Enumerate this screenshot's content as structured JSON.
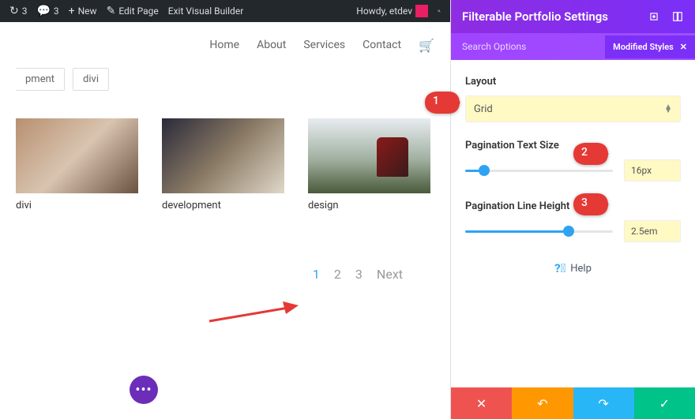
{
  "adminbar": {
    "refresh_count": "3",
    "comments_count": "3",
    "new_label": "New",
    "edit_label": "Edit Page",
    "exit_label": "Exit Visual Builder",
    "howdy": "Howdy, etdev"
  },
  "nav": {
    "items": [
      "Home",
      "About",
      "Services",
      "Contact"
    ]
  },
  "filters": [
    "pment",
    "divi"
  ],
  "portfolio_items": [
    {
      "title": "divi"
    },
    {
      "title": "development"
    },
    {
      "title": "design"
    }
  ],
  "pagination": {
    "pages": [
      "1",
      "2",
      "3"
    ],
    "next": "Next",
    "active": "1"
  },
  "callouts": {
    "c1": "1",
    "c2": "2",
    "c3": "3"
  },
  "settings": {
    "title": "Filterable Portfolio Settings",
    "search_placeholder": "Search Options",
    "chip": "Modified Styles",
    "layout_label": "Layout",
    "layout_value": "Grid",
    "pg_size_label": "Pagination Text Size",
    "pg_size_value": "16px",
    "pg_lh_label": "Pagination Line Height",
    "pg_lh_value": "2.5em",
    "help": "Help"
  },
  "slider": {
    "size_pct": 13,
    "lh_pct": 70
  }
}
